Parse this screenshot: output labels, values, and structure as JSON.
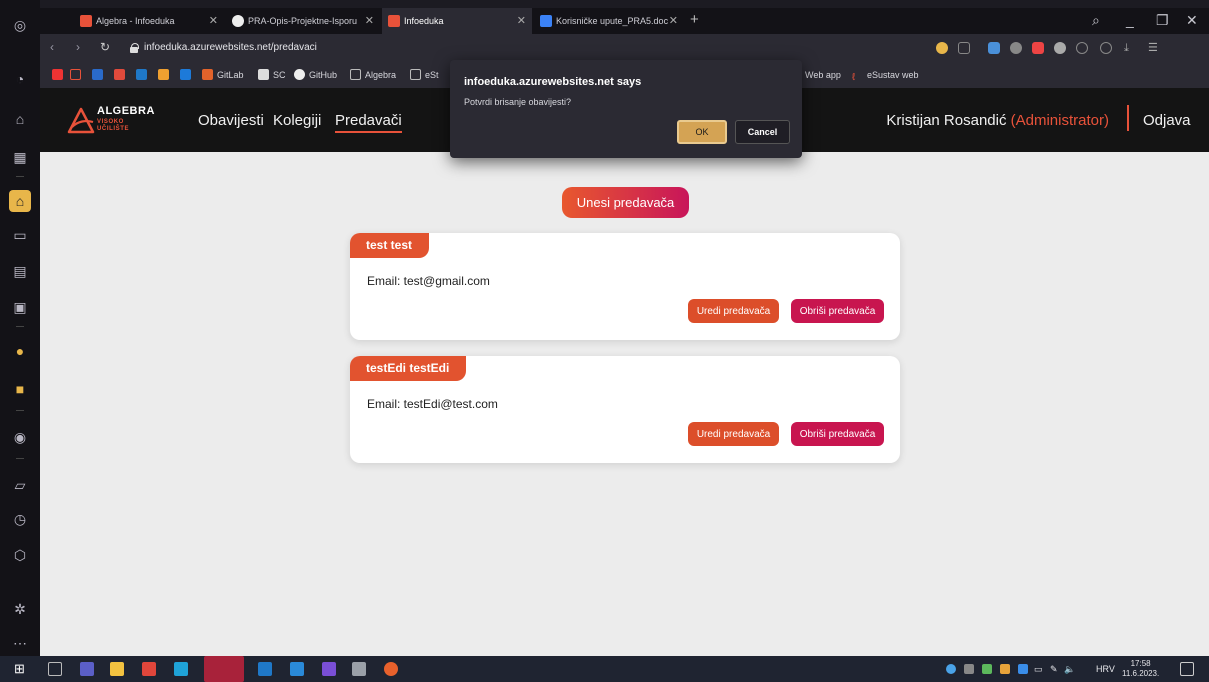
{
  "browser": {
    "tabs": [
      {
        "label": "Algebra - Infoeduka",
        "color": "#e8523a"
      },
      {
        "label": "PRA-Opis-Projektne-Isporu",
        "color": "#ffffff"
      },
      {
        "label": "Infoeduka",
        "color": "#e8523a"
      },
      {
        "label": "Korisničke upute_PRA5.doc",
        "color": "#3b82f6"
      }
    ],
    "new_tab": "+",
    "url": "infoeduka.azurewebsites.net/predavaci",
    "bookmarks": {
      "gitlab": "GitLab",
      "sc": "SC",
      "github": "GitHub",
      "algebra": "Algebra",
      "est": "eSt",
      "webapp": "Web app",
      "esustav": "eSustav web"
    }
  },
  "header": {
    "logo_title": "ALGEBRA",
    "logo_sub_1": "VISOKO",
    "logo_sub_2": "UČILIŠTE",
    "nav": {
      "obavijesti": "Obavijesti",
      "kolegiji": "Kolegiji",
      "predavaci": "Predavači"
    },
    "user_name": "Kristijan Rosandić",
    "user_role": "(Administrator)",
    "logout": "Odjava"
  },
  "main": {
    "add_button": "Unesi predavača",
    "lecturers": [
      {
        "name": "test test",
        "email": "Email: test@gmail.com"
      },
      {
        "name": "testEdi testEdi",
        "email": "Email: testEdi@test.com"
      }
    ],
    "edit_label": "Uredi predavača",
    "delete_label": "Obriši predavača"
  },
  "dialog": {
    "title": "infoeduka.azurewebsites.net says",
    "message": "Potvrdi brisanje obavijesti?",
    "ok": "OK",
    "cancel": "Cancel"
  },
  "taskbar": {
    "language": "HRV",
    "time": "17:58",
    "date": "11.6.2023."
  },
  "colors": {
    "accent": "#e8523a",
    "delete": "#c8154f"
  }
}
